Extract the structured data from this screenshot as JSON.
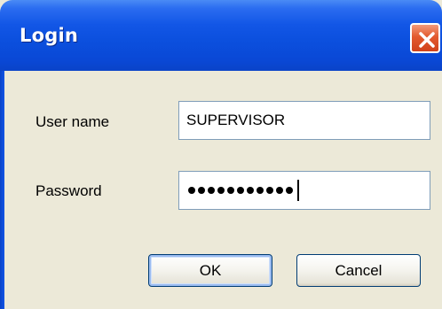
{
  "window": {
    "title": "Login"
  },
  "form": {
    "username_label": "User name",
    "username_value": "SUPERVISOR",
    "password_label": "Password",
    "password_masked_length": 11
  },
  "buttons": {
    "ok_label": "OK",
    "cancel_label": "Cancel"
  },
  "colors": {
    "titlebar": "#0a4fdd",
    "dialog_bg": "#ece9d8",
    "close_button": "#e35a2e",
    "field_border": "#7f9db9"
  },
  "icons": {
    "close": "close-icon"
  }
}
